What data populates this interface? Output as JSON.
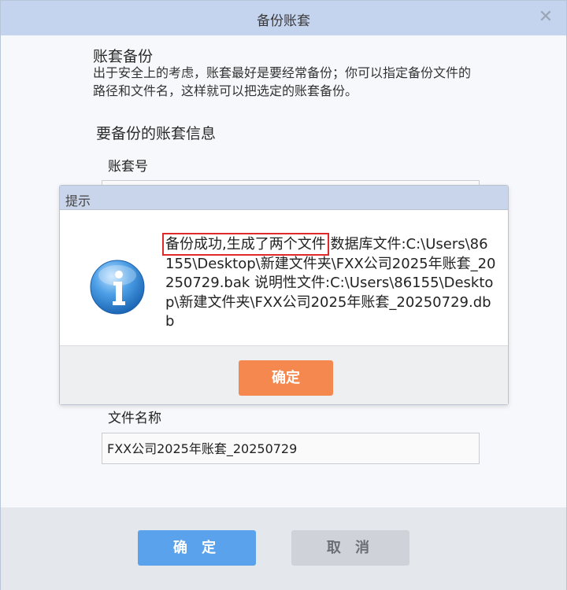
{
  "window": {
    "title": "备份账套",
    "close_glyph": "✕"
  },
  "content": {
    "heading": "账套备份",
    "description": "出于安全上的考虑，账套最好是要经常备份；你可以指定备份文件的路径和文件名，这样就可以把选定的账套备份。",
    "section_title": "要备份的账套信息",
    "account_no_label": "账套号",
    "account_no_value": "",
    "file_name_label": "文件名称",
    "file_name_value": "FXX公司2025年账套_20250729"
  },
  "footer": {
    "ok_label": "确 定",
    "cancel_label": "取 消"
  },
  "message_box": {
    "title": "提示",
    "icon": "info-icon",
    "highlight_text": "备份成功,生成了两个文件",
    "detail_text": "   数据库文件:C:\\Users\\86155\\Desktop\\新建文件夹\\FXX公司2025年账套_20250729.bak    说明性文件:C:\\Users\\86155\\Desktop\\新建文件夹\\FXX公司2025年账套_20250729.dbb",
    "ok_label": "确定"
  },
  "colors": {
    "primary_button": "#5aa2eb",
    "confirm_button": "#f5884f",
    "highlight_border": "#e02a2a",
    "titlebar": "#c4d3ee"
  }
}
